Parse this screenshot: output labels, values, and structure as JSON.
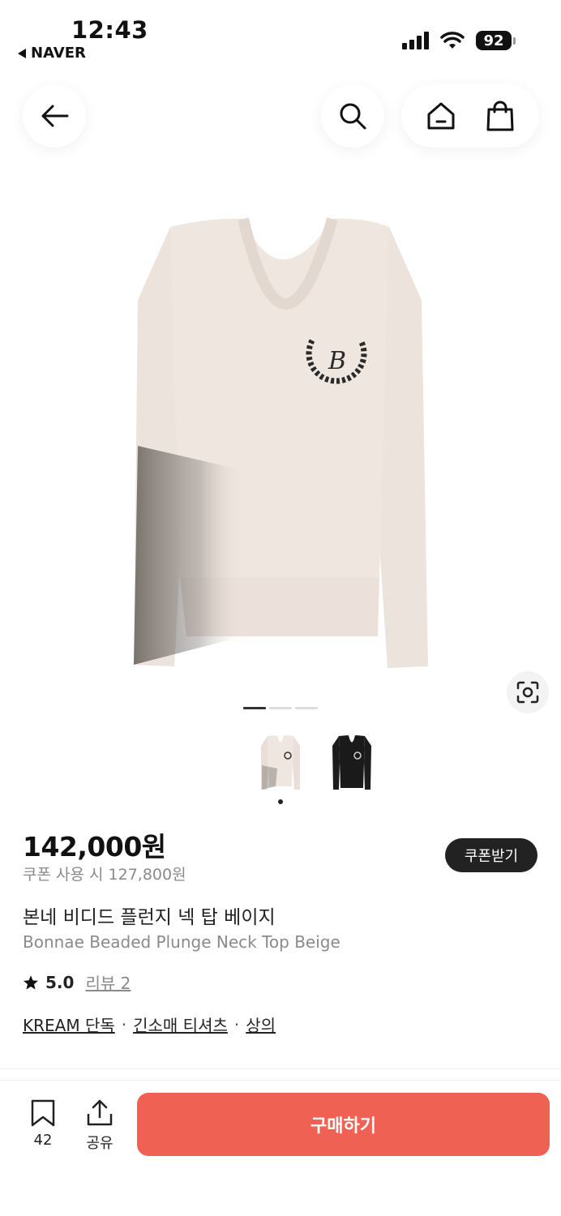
{
  "status_bar": {
    "time": "12:43",
    "back_app": "NAVER",
    "battery": "92",
    "icons": [
      "signal-icon",
      "wifi-icon",
      "battery-icon"
    ]
  },
  "header": {
    "icons": [
      "back-arrow-icon",
      "search-icon",
      "home-icon",
      "shopping-bag-icon"
    ]
  },
  "gallery": {
    "page_count": 3,
    "active_page": 1,
    "lens_icon": "visual-search-icon",
    "thumbnails": [
      {
        "name": "beige",
        "color": "#efe6df"
      },
      {
        "name": "black",
        "color": "#1a1a1a"
      }
    ],
    "selected_thumbnail": 1
  },
  "product": {
    "price": "142,000원",
    "coupon_price": "쿠폰 사용 시 127,800원",
    "coupon_button": "쿠폰받기",
    "name_ko": "본네 비디드 플런지 넥 탑 베이지",
    "name_en": "Bonnae Beaded Plunge Neck Top Beige",
    "rating": "5.0",
    "review": "리뷰 2",
    "tags": [
      "KREAM 단독",
      "긴소매 티셔츠",
      "상의"
    ],
    "tag_separator": "·"
  },
  "bottom_bar": {
    "bookmark_count": "42",
    "share_label": "공유",
    "buy_label": "구매하기",
    "buy_color": "#ef6253"
  }
}
